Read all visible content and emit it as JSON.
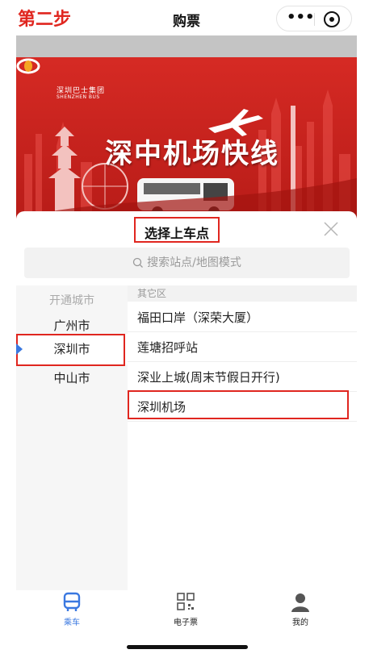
{
  "nav": {
    "step_label": "第二步",
    "title": "购票",
    "more_icon": "more-dots-icon",
    "close_icon": "record-circle-icon"
  },
  "banner": {
    "logo_cn": "深圳巴士集团",
    "logo_en": "SHENZHEN BUS",
    "title": "深中机场快线"
  },
  "sheet": {
    "title": "选择上车点",
    "close_icon": "close-icon",
    "search_placeholder": "搜索站点/地图模式",
    "left_header": "开通城市",
    "cities": [
      {
        "label": "广州市"
      },
      {
        "label": "深圳市",
        "selected": true
      },
      {
        "label": "中山市"
      }
    ],
    "group_header": "其它区",
    "stops": [
      {
        "label": "福田口岸（深荣大厦）"
      },
      {
        "label": "莲塘招呼站"
      },
      {
        "label": "深业上城(周末节假日开行)"
      },
      {
        "label": "深圳机场"
      }
    ]
  },
  "tabbar": {
    "items": [
      {
        "label": "乘车",
        "icon": "bus-icon",
        "active": true
      },
      {
        "label": "电子票",
        "icon": "qr-code-icon",
        "active": false
      },
      {
        "label": "我的",
        "icon": "user-icon",
        "active": false
      }
    ]
  },
  "colors": {
    "accent_red": "#e0261f",
    "active_blue": "#3a78e0",
    "banner_red": "#d32421"
  }
}
